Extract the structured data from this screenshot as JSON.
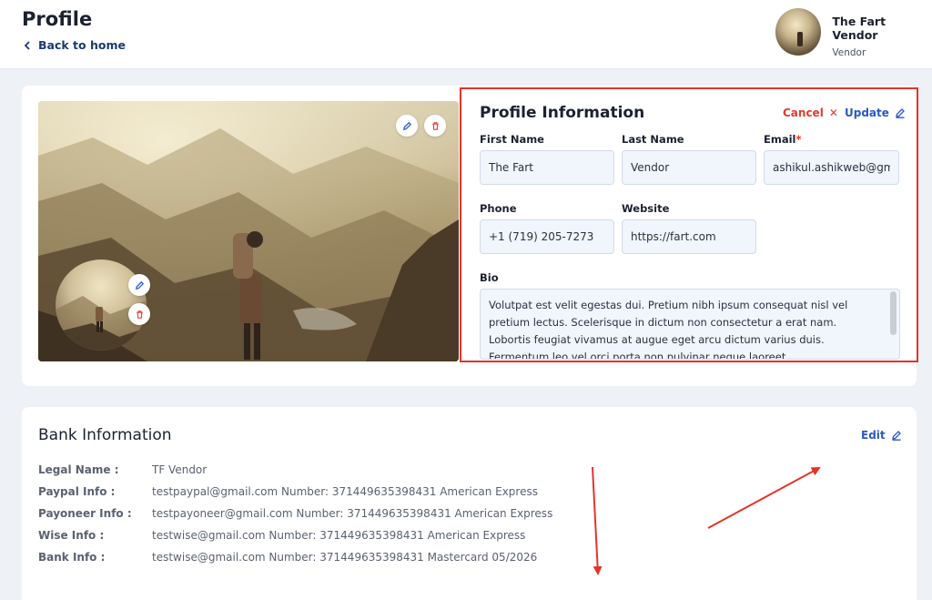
{
  "header": {
    "title": "Profile",
    "back_label": "Back to home",
    "user_name": "The Fart Vendor",
    "user_role": "Vendor"
  },
  "profile_form": {
    "title": "Profile Information",
    "cancel_label": "Cancel",
    "update_label": "Update",
    "first_name": {
      "label": "First Name",
      "value": "The Fart"
    },
    "last_name": {
      "label": "Last Name",
      "value": "Vendor"
    },
    "email": {
      "label": "Email",
      "required_mark": "*",
      "value": "ashikul.ashikweb@gmail.com"
    },
    "phone": {
      "label": "Phone",
      "value": "+1 (719) 205-7273"
    },
    "website": {
      "label": "Website",
      "value": "https://fart.com"
    },
    "bio": {
      "label": "Bio",
      "value": "Volutpat est velit egestas dui. Pretium nibh ipsum consequat nisl vel pretium lectus. Scelerisque in dictum non consectetur a erat nam. Lobortis feugiat vivamus at augue eget arcu dictum varius duis. Fermentum leo vel orci porta non pulvinar neque laoreet."
    }
  },
  "bank": {
    "title": "Bank Information",
    "edit_label": "Edit",
    "rows": [
      {
        "key": "Legal Name :",
        "value": "TF Vendor"
      },
      {
        "key": "Paypal Info :",
        "value": "testpaypal@gmail.com Number: 371449635398431 American Express"
      },
      {
        "key": "Payoneer Info :",
        "value": "testpayoneer@gmail.com Number: 371449635398431 American Express"
      },
      {
        "key": "Wise Info :",
        "value": "testwise@gmail.com Number: 371449635398431 American Express"
      },
      {
        "key": "Bank Info :",
        "value": "testwise@gmail.com Number: 371449635398431 Mastercard 05/2026"
      }
    ]
  },
  "colors": {
    "accent_blue": "#2a59c4",
    "cancel_red": "#e5392e",
    "highlight_red": "#e5332a",
    "background": "#eef1f6"
  }
}
